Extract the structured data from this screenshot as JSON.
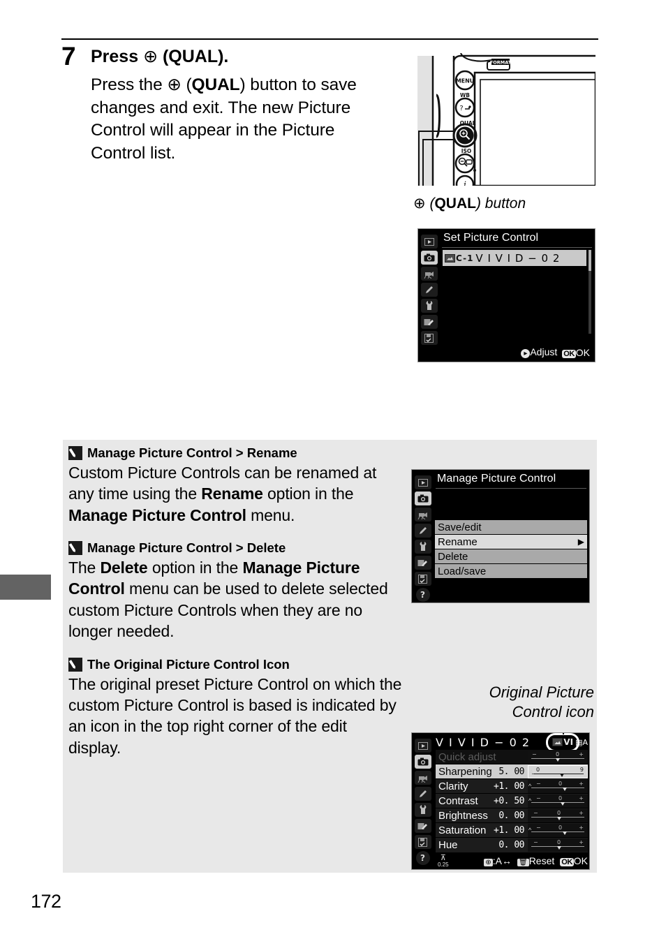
{
  "page": {
    "number": "172"
  },
  "step": {
    "number": "7",
    "title_prefix": "Press ",
    "title_icon": "⊕",
    "title_suffix": " (QUAL).",
    "title_qual": "QUAL",
    "body_part1": "Press the ",
    "body_icon": "⊕",
    "body_part2": " (",
    "body_qual": "QUAL",
    "body_part3": ") button to save changes and exit.  The new Picture Control will appear in the Picture Control list."
  },
  "camera_figure": {
    "caption_icon": "⊕",
    "caption_open": " (",
    "caption_bold": "QUAL",
    "caption_close": ") button",
    "button_labels": [
      "FORMAT",
      "MENU",
      "WB",
      "QUAL",
      "ISO",
      "i"
    ]
  },
  "lcd_set_picture_control": {
    "title": "Set Picture Control",
    "selected_item": {
      "badge": "C-1",
      "name": "V I V I D − 0 2"
    },
    "hint_adjust": "Adjust",
    "hint_ok": "OK",
    "key_ok": "OK",
    "sidebar_icons": [
      "playback-icon",
      "shooting-menu-icon",
      "movie-menu-icon",
      "custom-settings-icon",
      "setup-menu-icon",
      "retouch-menu-icon",
      "recent-settings-icon"
    ]
  },
  "lcd_manage_picture_control": {
    "title": "Manage Picture Control",
    "options": [
      {
        "label": "Save/edit",
        "highlighted": false,
        "arrow": ""
      },
      {
        "label": "Rename",
        "highlighted": true,
        "arrow": "▶"
      },
      {
        "label": "Delete",
        "highlighted": false,
        "arrow": ""
      },
      {
        "label": "Load/save",
        "highlighted": false,
        "arrow": ""
      }
    ],
    "help_icon": "?"
  },
  "lcd_vivid_edit": {
    "title": "V I V I D − 0 2",
    "original_badge": "VI",
    "corner_indicator": "A",
    "rows": [
      {
        "label": "Quick adjust",
        "value": "",
        "dim": true,
        "selected": false,
        "slider": {
          "min_label": "−",
          "mid_label": "0",
          "max_label": "+",
          "pos": 50,
          "caret": false
        }
      },
      {
        "label": "Sharpening",
        "value": "5. 00",
        "dim": false,
        "selected": true,
        "slider": {
          "min_label": "0",
          "mid_label": "",
          "max_label": "9",
          "pos": 55,
          "caret": true
        }
      },
      {
        "label": "Clarity",
        "value": "+1. 00",
        "dim": false,
        "selected": false,
        "slider": {
          "min_label": "−",
          "mid_label": "0",
          "max_label": "+",
          "pos": 58,
          "caret": true
        }
      },
      {
        "label": "Contrast",
        "value": "+0. 50",
        "dim": false,
        "selected": false,
        "slider": {
          "min_label": "−",
          "mid_label": "0",
          "max_label": "+",
          "pos": 54,
          "caret": true
        }
      },
      {
        "label": "Brightness",
        "value": "0. 00",
        "dim": false,
        "selected": false,
        "slider": {
          "min_label": "−",
          "mid_label": "0",
          "max_label": "+",
          "pos": 50,
          "caret": false
        }
      },
      {
        "label": "Saturation",
        "value": "+1. 00",
        "dim": false,
        "selected": false,
        "slider": {
          "min_label": "−",
          "mid_label": "0",
          "max_label": "+",
          "pos": 58,
          "caret": true
        }
      },
      {
        "label": "Hue",
        "value": "0. 00",
        "dim": false,
        "selected": false,
        "slider": {
          "min_label": "−",
          "mid_label": "0",
          "max_label": "+",
          "pos": 50,
          "caret": false
        }
      }
    ],
    "footer": {
      "grid_value": "0.25",
      "auto_label": ":A↔",
      "reset_label": "Reset",
      "ok_label": "OK",
      "ok_key": "OK",
      "help_icon": "?"
    }
  },
  "notes": [
    {
      "heading": "Manage Picture Control > Rename",
      "body_1": "Custom Picture Controls can be renamed at any time using the ",
      "bold_1": "Rename",
      "body_2": " option in the ",
      "bold_2": "Manage Picture Control",
      "body_3": " menu."
    },
    {
      "heading": "Manage Picture Control > Delete",
      "body_1": "The ",
      "bold_1": "Delete",
      "body_2": " option in the ",
      "bold_2": "Manage Picture Control",
      "body_3": " menu can be used to delete selected custom Picture Controls when they are no longer needed."
    },
    {
      "heading": "The Original Picture Control Icon",
      "body_1": "The original preset Picture Control on which the custom Picture Control is based is indicated by an icon in the top right corner of the edit display.",
      "bold_1": "",
      "body_2": "",
      "bold_2": "",
      "body_3": ""
    }
  ],
  "original_icon_caption": {
    "line1": "Original Picture",
    "line2": "Control icon"
  },
  "colors": {
    "note_panel_bg": "#e8e8e8",
    "margin_tab": "#636363",
    "lcd_bg": "#000000",
    "highlight": "#cfcfcf"
  }
}
